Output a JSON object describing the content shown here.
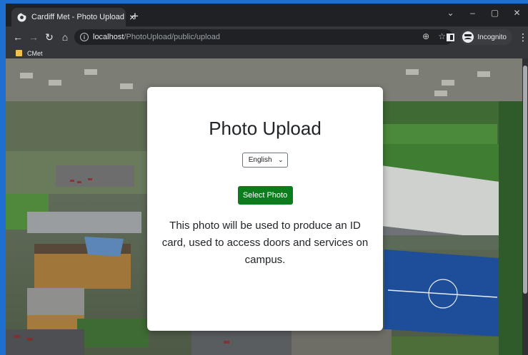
{
  "browser": {
    "tab_title": "Cardiff Met - Photo Upload",
    "new_tab_symbol": "+",
    "url_host": "localhost",
    "url_path": "/PhotoUpload/public/upload",
    "incognito_label": "Incognito",
    "bookmark_label": "CMet"
  },
  "page": {
    "title": "Photo Upload",
    "language": "English",
    "upload_button": "Select Photo",
    "description": "This photo will be used to produce an ID card, used to access doors and services on campus."
  }
}
